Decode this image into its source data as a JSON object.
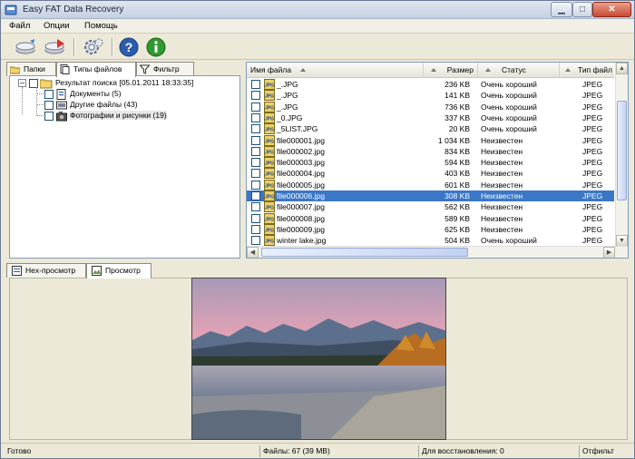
{
  "window": {
    "title": "Easy FAT Data Recovery"
  },
  "menu": [
    "Файл",
    "Опции",
    "Помощь"
  ],
  "left_tabs": [
    "Папки",
    "Типы файлов",
    "Фильтр"
  ],
  "tree": {
    "root": "Результат поиска [05.01.2011 18:33:35]",
    "children": [
      "Документы (5)",
      "Другие файлы (43)",
      "Фотографии и рисунки (19)"
    ]
  },
  "columns": {
    "name": "Имя файла",
    "size": "Размер",
    "status": "Статус",
    "type": "Тип файл"
  },
  "files": [
    {
      "name": "_.JPG",
      "size": "236 KB",
      "status": "Очень хороший",
      "type": "JPEG"
    },
    {
      "name": "_.JPG",
      "size": "141 KB",
      "status": "Очень хороший",
      "type": "JPEG"
    },
    {
      "name": "_.JPG",
      "size": "736 KB",
      "status": "Очень хороший",
      "type": "JPEG"
    },
    {
      "name": "_0.JPG",
      "size": "337 KB",
      "status": "Очень хороший",
      "type": "JPEG"
    },
    {
      "name": "_5LIST.JPG",
      "size": "20 KB",
      "status": "Очень хороший",
      "type": "JPEG"
    },
    {
      "name": "file000001.jpg",
      "size": "1 034 KB",
      "status": "Неизвестен",
      "type": "JPEG"
    },
    {
      "name": "file000002.jpg",
      "size": "834 KB",
      "status": "Неизвестен",
      "type": "JPEG"
    },
    {
      "name": "file000003.jpg",
      "size": "594 KB",
      "status": "Неизвестен",
      "type": "JPEG"
    },
    {
      "name": "file000004.jpg",
      "size": "403 KB",
      "status": "Неизвестен",
      "type": "JPEG"
    },
    {
      "name": "file000005.jpg",
      "size": "601 KB",
      "status": "Неизвестен",
      "type": "JPEG"
    },
    {
      "name": "file000006.jpg",
      "size": "308 KB",
      "status": "Неизвестен",
      "type": "JPEG"
    },
    {
      "name": "file000007.jpg",
      "size": "562 KB",
      "status": "Неизвестен",
      "type": "JPEG"
    },
    {
      "name": "file000008.jpg",
      "size": "589 KB",
      "status": "Неизвестен",
      "type": "JPEG"
    },
    {
      "name": "file000009.jpg",
      "size": "625 KB",
      "status": "Неизвестен",
      "type": "JPEG"
    },
    {
      "name": "winter lake.jpg",
      "size": "504 KB",
      "status": "Очень хороший",
      "type": "JPEG"
    }
  ],
  "selected_file_index": 10,
  "bottom_tabs": [
    "Hex-просмотр",
    "Просмотр"
  ],
  "status": {
    "ready": "Готово",
    "files": "Файлы: 67 (39 MB)",
    "restore": "Для восстановления: 0",
    "filtered": "Отфильт"
  },
  "colors": {
    "selection": "#3a77c7",
    "help_icon": "#2a5db0",
    "info_icon": "#2f9a2f"
  }
}
